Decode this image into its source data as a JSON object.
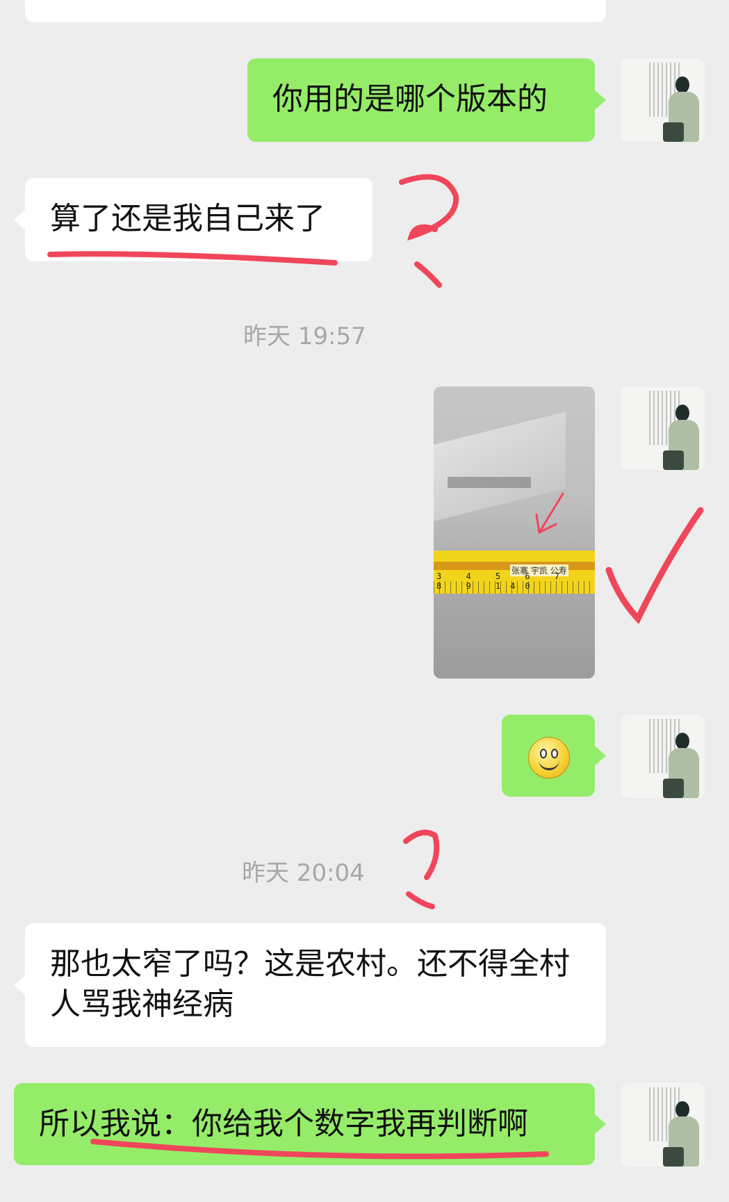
{
  "messages": [
    {
      "side": "incoming",
      "text": ""
    },
    {
      "side": "outgoing",
      "text": "你用的是哪个版本的"
    },
    {
      "side": "incoming",
      "text": "算了还是我自己来了"
    },
    {
      "side": "outgoing",
      "type": "image",
      "tape_label": "张寨 宇凯 公寿",
      "tape_numbers": "3 4 5 6 7 8 9 140"
    },
    {
      "side": "outgoing",
      "type": "emoji",
      "emoji": "smile-emoji"
    },
    {
      "side": "incoming",
      "text": "那也太窄了吗？这是农村。还不得全村人骂我神经病"
    },
    {
      "side": "outgoing",
      "text": "所以我说：你给我个数字我再判断啊"
    }
  ],
  "timestamps": [
    "昨天 19:57",
    "昨天 20:04"
  ],
  "colors": {
    "background": "#ededed",
    "outgoing_bubble": "#95ec69",
    "incoming_bubble": "#ffffff",
    "annotation_red": "#f0465a"
  }
}
